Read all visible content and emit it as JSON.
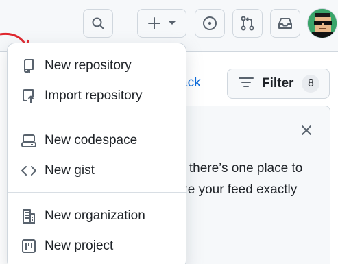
{
  "header": {
    "buttons": [
      {
        "icon": "search-icon"
      },
      {
        "icon": "plus-icon",
        "dropdown_icon": "triangle-down-icon"
      },
      {
        "icon": "issue-opened-icon"
      },
      {
        "icon": "git-pull-request-icon"
      },
      {
        "icon": "inbox-icon"
      }
    ],
    "avatar_icon": "avatar"
  },
  "page": {
    "back_link": "ack",
    "filter_label": "Filter",
    "filter_count": "8",
    "card_text_1": "o there’s one place to",
    "card_text_2": "ize your feed exactly"
  },
  "menu": {
    "items": [
      {
        "label": "New repository",
        "icon": "repo-icon"
      },
      {
        "label": "Import repository",
        "icon": "repo-push-icon"
      },
      {
        "label": "New codespace",
        "icon": "codespaces-icon"
      },
      {
        "label": "New gist",
        "icon": "code-icon"
      },
      {
        "label": "New organization",
        "icon": "organization-icon"
      },
      {
        "label": "New project",
        "icon": "project-icon"
      }
    ]
  },
  "colors": {
    "accent_link": "#0969da",
    "arrow": "#e0262d",
    "text": "#1f2328",
    "border": "#d0d7de",
    "header_bg": "#f6f8fa"
  }
}
